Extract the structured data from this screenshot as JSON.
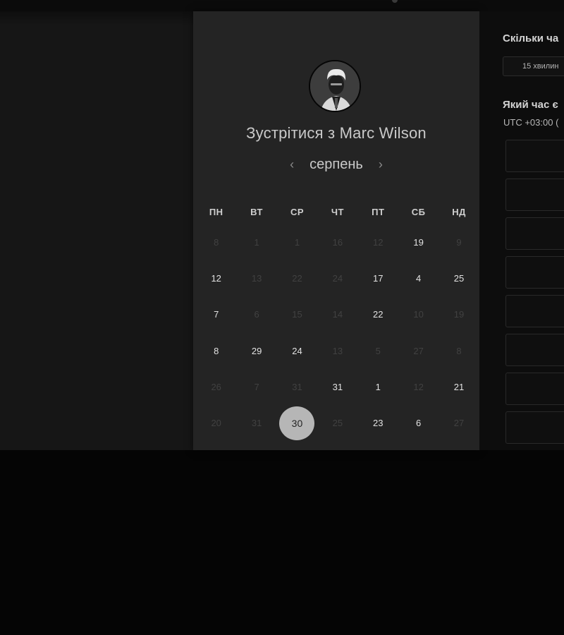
{
  "host": {
    "meet_title": "Зустрітися з Marc Wilson"
  },
  "calendar": {
    "month": "серпень",
    "prev_icon": "chevron-left-icon",
    "next_icon": "chevron-right-icon",
    "weekdays": [
      "ПН",
      "ВТ",
      "СР",
      "ЧТ",
      "ПТ",
      "СБ",
      "НД"
    ],
    "days": [
      {
        "label": "8",
        "available": false
      },
      {
        "label": "1",
        "available": false
      },
      {
        "label": "1",
        "available": false
      },
      {
        "label": "16",
        "available": false
      },
      {
        "label": "12",
        "available": false
      },
      {
        "label": "19",
        "available": true
      },
      {
        "label": "9",
        "available": false
      },
      {
        "label": "12",
        "available": true
      },
      {
        "label": "13",
        "available": false
      },
      {
        "label": "22",
        "available": false
      },
      {
        "label": "24",
        "available": false
      },
      {
        "label": "17",
        "available": true
      },
      {
        "label": "4",
        "available": true
      },
      {
        "label": "25",
        "available": true
      },
      {
        "label": "7",
        "available": true
      },
      {
        "label": "6",
        "available": false
      },
      {
        "label": "15",
        "available": false
      },
      {
        "label": "14",
        "available": false
      },
      {
        "label": "22",
        "available": true
      },
      {
        "label": "10",
        "available": false
      },
      {
        "label": "19",
        "available": false
      },
      {
        "label": "8",
        "available": true
      },
      {
        "label": "29",
        "available": true
      },
      {
        "label": "24",
        "available": true
      },
      {
        "label": "13",
        "available": false
      },
      {
        "label": "5",
        "available": false
      },
      {
        "label": "27",
        "available": false
      },
      {
        "label": "8",
        "available": false
      },
      {
        "label": "26",
        "available": false
      },
      {
        "label": "7",
        "available": false
      },
      {
        "label": "31",
        "available": false
      },
      {
        "label": "31",
        "available": true
      },
      {
        "label": "1",
        "available": true
      },
      {
        "label": "12",
        "available": false
      },
      {
        "label": "21",
        "available": true
      },
      {
        "label": "20",
        "available": false
      },
      {
        "label": "31",
        "available": false
      },
      {
        "label": "30",
        "available": true,
        "selected": true
      },
      {
        "label": "25",
        "available": false
      },
      {
        "label": "23",
        "available": true
      },
      {
        "label": "6",
        "available": true
      },
      {
        "label": "27",
        "available": false
      }
    ]
  },
  "booking": {
    "duration_heading": "Скільки ча",
    "duration_value": "15 хвилин",
    "time_heading": "Який час є",
    "timezone": "UTC +03:00 (",
    "slots_visible": 8
  },
  "colors": {
    "card_bg": "#242424",
    "selected_day_bg": "#b6b6b6",
    "page_bg": "#161616"
  }
}
